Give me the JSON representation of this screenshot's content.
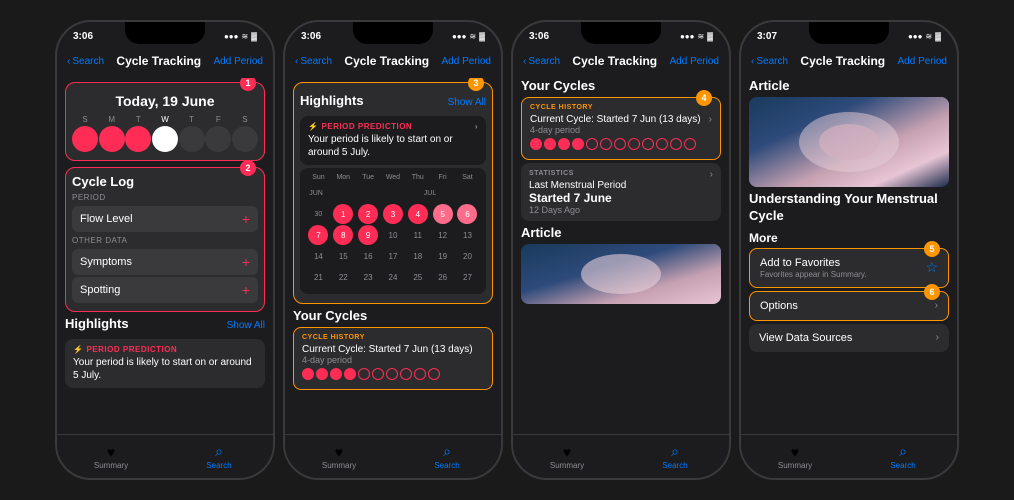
{
  "phone1": {
    "status_time": "3:06",
    "nav_back": "Search",
    "nav_title": "Cycle Tracking",
    "nav_action": "Add Period",
    "date_label": "Today, 19 June",
    "section1_number": "1",
    "section2_number": "2",
    "cycle_log_label": "Cycle Log",
    "period_label": "PERIOD",
    "flow_level": "Flow Level",
    "other_data": "OTHER DATA",
    "symptoms": "Symptoms",
    "spotting": "Spotting",
    "highlights_title": "Highlights",
    "show_all": "Show All",
    "prediction_tag": "PERIOD PREDICTION",
    "prediction_text": "Your period is likely to start on or around 5 July.",
    "tab_summary": "Summary",
    "tab_search": "Search"
  },
  "phone2": {
    "status_time": "3:06",
    "nav_back": "Search",
    "nav_title": "Cycle Tracking",
    "nav_action": "Add Period",
    "highlights_title": "Highlights",
    "section3_number": "3",
    "show_all": "Show All",
    "prediction_tag": "PERIOD PREDICTION",
    "prediction_text": "Your period is likely to start on or around 5 July.",
    "cal_days": [
      "Sun",
      "Mon",
      "Tue",
      "Wed",
      "Thu",
      "Fri",
      "Sat"
    ],
    "your_cycles": "Your Cycles",
    "cycle_history_tag": "CYCLE HISTORY",
    "current_cycle": "Current Cycle: Started 7 Jun (13 days)",
    "period_days": "4-day period",
    "tab_summary": "Summary",
    "tab_search": "Search"
  },
  "phone3": {
    "status_time": "3:06",
    "nav_back": "Search",
    "nav_title": "Cycle Tracking",
    "nav_action": "Add Period",
    "your_cycles": "Your Cycles",
    "section4_number": "4",
    "cycle_history_tag": "CYCLE HISTORY",
    "current_cycle": "Current Cycle: Started 7 Jun (13 days)",
    "period_days": "4-day period",
    "stats_tag": "STATISTICS",
    "last_menstrual": "Last Menstrual Period",
    "started_date": "Started 7 June",
    "days_ago": "12 Days Ago",
    "article_label": "Article",
    "tab_summary": "Summary",
    "tab_search": "Search"
  },
  "phone4": {
    "status_time": "3:07",
    "nav_back": "Search",
    "nav_title": "Cycle Tracking",
    "nav_action": "Add Period",
    "article_label": "Article",
    "article_title": "Understanding Your Menstrual Cycle",
    "more_label": "More",
    "section5_number": "5",
    "section6_number": "6",
    "add_favorites": "Add to Favorites",
    "favorites_sub": "Favorites appear in Summary.",
    "options": "Options",
    "view_data_sources": "View Data Sources",
    "tab_summary": "Summary",
    "tab_search": "Search"
  },
  "icons": {
    "back_chevron": "‹",
    "heart": "♥",
    "search": "⌕",
    "chevron_right": "›",
    "star": "☆",
    "star_filled": "★",
    "signal": "▌▌▌",
    "wifi": "WiFi",
    "battery": "▓",
    "plus": "+",
    "flame": "⚡"
  }
}
